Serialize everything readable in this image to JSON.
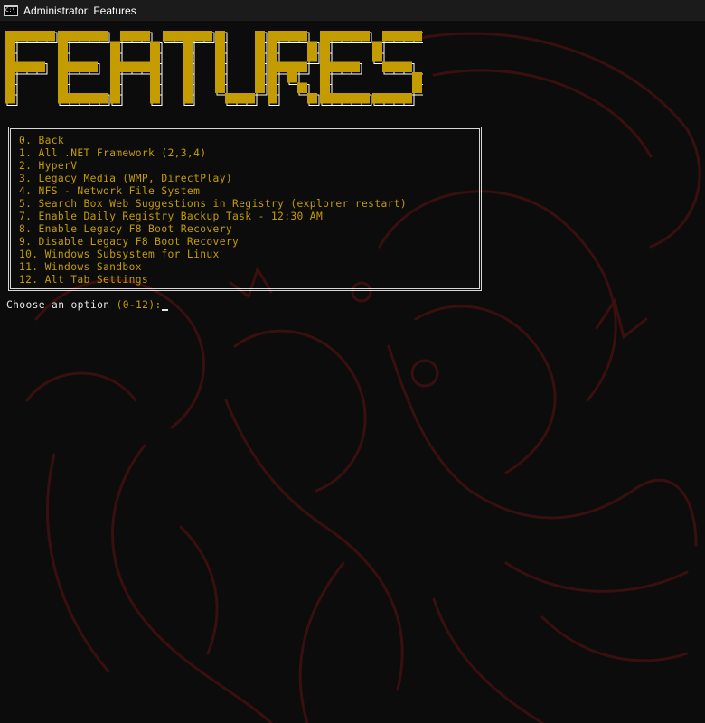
{
  "window": {
    "title": "Administrator:  Features",
    "icon": "cmd-icon"
  },
  "banner": {
    "text": "FEATURES",
    "fill_color": "#c49c00",
    "outline_color": "#ffffff"
  },
  "menu": {
    "items": [
      "0. Back",
      "1. All .NET Framework (2,3,4)",
      "2. HyperV",
      "3. Legacy Media (WMP, DirectPlay)",
      "4. NFS - Network File System",
      "5. Search Box Web Suggestions in Registry (explorer restart)",
      "7. Enable Daily Registry Backup Task - 12:30 AM",
      "8. Enable Legacy F8 Boot Recovery",
      "9. Disable Legacy F8 Boot Recovery",
      "10. Windows Subsystem for Linux",
      "11. Windows Sandbox",
      "12. Alt Tab Settings"
    ],
    "text_color": "#c49c00",
    "border_color": "#d8d8d8"
  },
  "prompt": {
    "label": "Choose an option ",
    "range": "(0-12):",
    "value": ""
  },
  "colors": {
    "background": "#0c0c0c",
    "titlebar": "#1b1b1b",
    "dragon": "#3a0f0f"
  }
}
